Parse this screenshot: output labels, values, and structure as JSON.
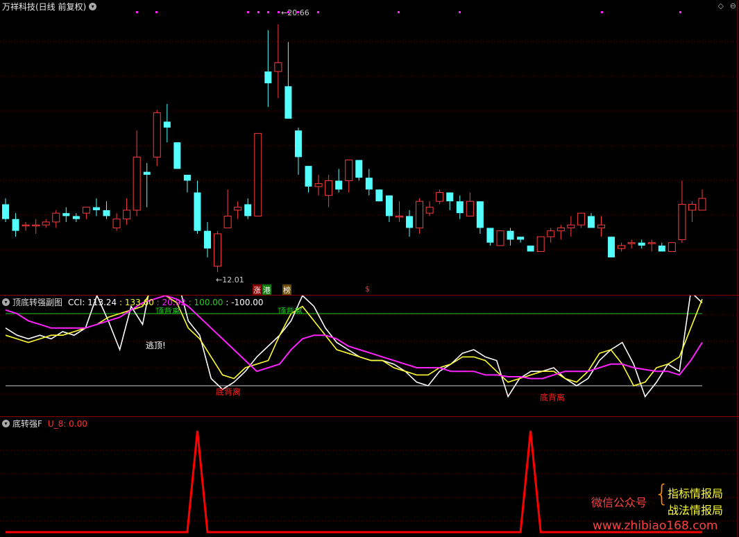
{
  "main_chart": {
    "title": "万祥科技(日线 前复权)",
    "high_label": "20.66",
    "low_label": "12.01",
    "tags": [
      {
        "text": "涨"
      },
      {
        "text": "港"
      },
      {
        "text": "榜"
      },
      {
        "text": "$"
      }
    ]
  },
  "indicator_panel": {
    "title": "顶底转强副图",
    "readout_prefix": "CCI: ",
    "values": [
      "113.24",
      "133.60",
      "20.92",
      "100.00",
      "-100.00"
    ],
    "annotations": [
      "顶背离",
      "顶背离",
      "逃顶!",
      "底背离",
      "底背离"
    ]
  },
  "signal_panel": {
    "title": "底转强F",
    "readout": "U_8: 0.00"
  },
  "watermark": {
    "left": "微信公众号",
    "right_top": "指标情报局",
    "right_bottom": "战法情报局",
    "url": "www.zhibiao168.com"
  },
  "colors": {
    "up": "#ff3c3c",
    "down": "#54ffff",
    "cci_white": "#ffffff",
    "cci_yellow": "#ffff33",
    "cci_magenta": "#ff22ff",
    "level_green": "#22cc22",
    "signal_red": "#ff0000"
  },
  "chart_data": [
    {
      "type": "candlestick",
      "title": "万祥科技(日线 前复权)",
      "high": 20.66,
      "low": 12.01,
      "candles": [
        [
          14.4,
          14.6,
          13.8,
          13.9
        ],
        [
          13.9,
          14.1,
          13.3,
          13.5
        ],
        [
          13.7,
          13.8,
          13.5,
          13.7
        ],
        [
          13.7,
          13.9,
          13.4,
          13.7
        ],
        [
          13.7,
          13.9,
          13.6,
          13.8
        ],
        [
          13.8,
          14.2,
          13.6,
          14.1
        ],
        [
          14.1,
          14.3,
          13.8,
          14.0
        ],
        [
          14.0,
          14.1,
          13.8,
          13.9
        ],
        [
          14.1,
          14.3,
          13.9,
          14.3
        ],
        [
          14.3,
          14.6,
          14.0,
          14.2
        ],
        [
          14.2,
          14.5,
          13.9,
          14.0
        ],
        [
          13.6,
          14.1,
          13.5,
          13.9
        ],
        [
          13.9,
          14.6,
          13.7,
          14.2
        ],
        [
          14.2,
          16.9,
          14.0,
          16.0
        ],
        [
          15.5,
          15.8,
          14.3,
          15.4
        ],
        [
          16.0,
          17.6,
          15.7,
          17.5
        ],
        [
          17.2,
          17.8,
          16.5,
          17.0
        ],
        [
          16.5,
          16.5,
          15.7,
          15.6
        ],
        [
          15.4,
          15.4,
          14.8,
          15.2
        ],
        [
          14.8,
          15.2,
          13.4,
          13.5
        ],
        [
          13.5,
          13.8,
          12.6,
          12.9
        ],
        [
          12.3,
          13.5,
          12.1,
          13.4
        ],
        [
          13.6,
          14.9,
          13.6,
          14.0
        ],
        [
          14.2,
          14.5,
          13.9,
          14.3
        ],
        [
          14.4,
          14.6,
          13.9,
          14.0
        ],
        [
          14.0,
          16.8,
          14.0,
          16.8
        ],
        [
          18.9,
          20.3,
          17.7,
          18.5
        ],
        [
          18.9,
          20.5,
          18.0,
          19.2
        ],
        [
          18.4,
          19.9,
          17.4,
          17.3
        ],
        [
          16.9,
          17.0,
          15.4,
          16.0
        ],
        [
          15.7,
          15.7,
          14.8,
          15.0
        ],
        [
          15.0,
          15.4,
          14.7,
          15.1
        ],
        [
          14.7,
          15.4,
          14.3,
          15.2
        ],
        [
          15.2,
          15.6,
          14.8,
          14.9
        ],
        [
          15.2,
          15.9,
          14.8,
          15.9
        ],
        [
          15.9,
          15.9,
          15.2,
          15.3
        ],
        [
          15.3,
          15.6,
          14.7,
          14.9
        ],
        [
          14.9,
          14.9,
          14.5,
          14.5
        ],
        [
          14.7,
          14.7,
          13.8,
          14.0
        ],
        [
          14.0,
          14.5,
          13.8,
          14.0
        ],
        [
          14.0,
          14.2,
          13.3,
          13.6
        ],
        [
          13.6,
          14.6,
          13.4,
          14.5
        ],
        [
          14.1,
          14.5,
          14.0,
          14.3
        ],
        [
          14.5,
          14.9,
          14.4,
          14.8
        ],
        [
          14.8,
          14.8,
          14.2,
          14.5
        ],
        [
          14.5,
          14.7,
          13.9,
          14.1
        ],
        [
          14.0,
          14.8,
          14.0,
          14.5
        ],
        [
          14.5,
          14.5,
          13.4,
          13.6
        ],
        [
          13.6,
          13.6,
          13.0,
          13.1
        ],
        [
          13.0,
          13.5,
          13.0,
          13.5
        ],
        [
          13.5,
          13.6,
          13.0,
          13.2
        ],
        [
          13.3,
          13.3,
          13.1,
          13.2
        ],
        [
          13.0,
          13.0,
          12.8,
          12.8
        ],
        [
          12.8,
          13.3,
          12.8,
          13.3
        ],
        [
          13.3,
          13.6,
          13.1,
          13.5
        ],
        [
          13.5,
          13.7,
          13.2,
          13.6
        ],
        [
          13.6,
          14.0,
          13.3,
          13.7
        ],
        [
          13.7,
          14.1,
          13.6,
          14.1
        ],
        [
          14.0,
          14.1,
          13.6,
          13.6
        ],
        [
          13.6,
          14.0,
          13.3,
          13.7
        ],
        [
          13.3,
          13.3,
          12.6,
          12.6
        ],
        [
          12.9,
          13.1,
          12.8,
          13.0
        ],
        [
          13.1,
          13.2,
          12.9,
          13.1
        ],
        [
          13.1,
          13.2,
          12.9,
          13.0
        ],
        [
          13.1,
          13.2,
          12.8,
          13.1
        ],
        [
          13.0,
          13.1,
          12.8,
          12.8
        ],
        [
          12.8,
          13.1,
          12.8,
          13.1
        ],
        [
          13.2,
          15.2,
          13.1,
          14.4
        ],
        [
          14.2,
          14.5,
          13.8,
          14.4
        ],
        [
          14.2,
          14.9,
          14.2,
          14.6
        ]
      ]
    },
    {
      "type": "line",
      "title": "顶底转强副图",
      "levels": [
        100,
        -100
      ],
      "series": [
        {
          "name": "",
          "color": "white",
          "values": [
            60,
            40,
            30,
            40,
            30,
            50,
            40,
            60,
            150,
            80,
            0,
            120,
            70,
            230,
            160,
            200,
            80,
            40,
            -80,
            -110,
            -90,
            -60,
            -20,
            10,
            40,
            80,
            150,
            120,
            60,
            20,
            0,
            -20,
            -30,
            -30,
            -40,
            -60,
            -90,
            -100,
            -60,
            -40,
            -10,
            0,
            -20,
            -30,
            -130,
            -80,
            -60,
            -60,
            -50,
            -80,
            -100,
            -80,
            -30,
            0,
            20,
            -40,
            -130,
            -90,
            -40,
            -60,
            160,
            130
          ]
        },
        {
          "name": "",
          "color": "yellow",
          "values": [
            40,
            30,
            20,
            30,
            40,
            40,
            50,
            60,
            70,
            90,
            100,
            110,
            120,
            180,
            150,
            130,
            60,
            30,
            -20,
            -70,
            -80,
            -50,
            -40,
            -30,
            40,
            100,
            120,
            80,
            40,
            0,
            -10,
            -20,
            -30,
            -30,
            -50,
            -60,
            -70,
            -70,
            -50,
            -40,
            -20,
            -20,
            -30,
            -60,
            -90,
            -80,
            -70,
            -60,
            -60,
            -80,
            -90,
            -60,
            -10,
            0,
            -40,
            -100,
            -90,
            -50,
            -40,
            -20,
            60,
            140
          ]
        },
        {
          "name": "",
          "color": "magenta",
          "values": [
            110,
            100,
            80,
            70,
            60,
            60,
            60,
            60,
            70,
            80,
            90,
            110,
            130,
            140,
            150,
            140,
            120,
            90,
            60,
            30,
            0,
            -30,
            -60,
            -50,
            -40,
            0,
            30,
            40,
            40,
            30,
            10,
            0,
            -10,
            -20,
            -30,
            -40,
            -50,
            -50,
            -50,
            -60,
            -60,
            -60,
            -70,
            -70,
            -75,
            -75,
            -80,
            -80,
            -70,
            -60,
            -60,
            -60,
            -50,
            -40,
            -40,
            -50,
            -55,
            -60,
            -60,
            -70,
            -30,
            20
          ]
        }
      ]
    },
    {
      "type": "line",
      "title": "底转强F",
      "series": [
        {
          "name": "U_8",
          "values": [
            0,
            0,
            0,
            0,
            0,
            0,
            0,
            0,
            0,
            0,
            0,
            0,
            0,
            0,
            0,
            0,
            0,
            0,
            0,
            1,
            0,
            0,
            0,
            0,
            0,
            0,
            0,
            0,
            0,
            0,
            0,
            0,
            0,
            0,
            0,
            0,
            0,
            0,
            0,
            0,
            0,
            0,
            0,
            0,
            0,
            0,
            0,
            0,
            0,
            0,
            0,
            0,
            1,
            0,
            0,
            0,
            0,
            0,
            0,
            0,
            0,
            0,
            0,
            0,
            0,
            0,
            0,
            0,
            0,
            0
          ]
        }
      ]
    }
  ]
}
